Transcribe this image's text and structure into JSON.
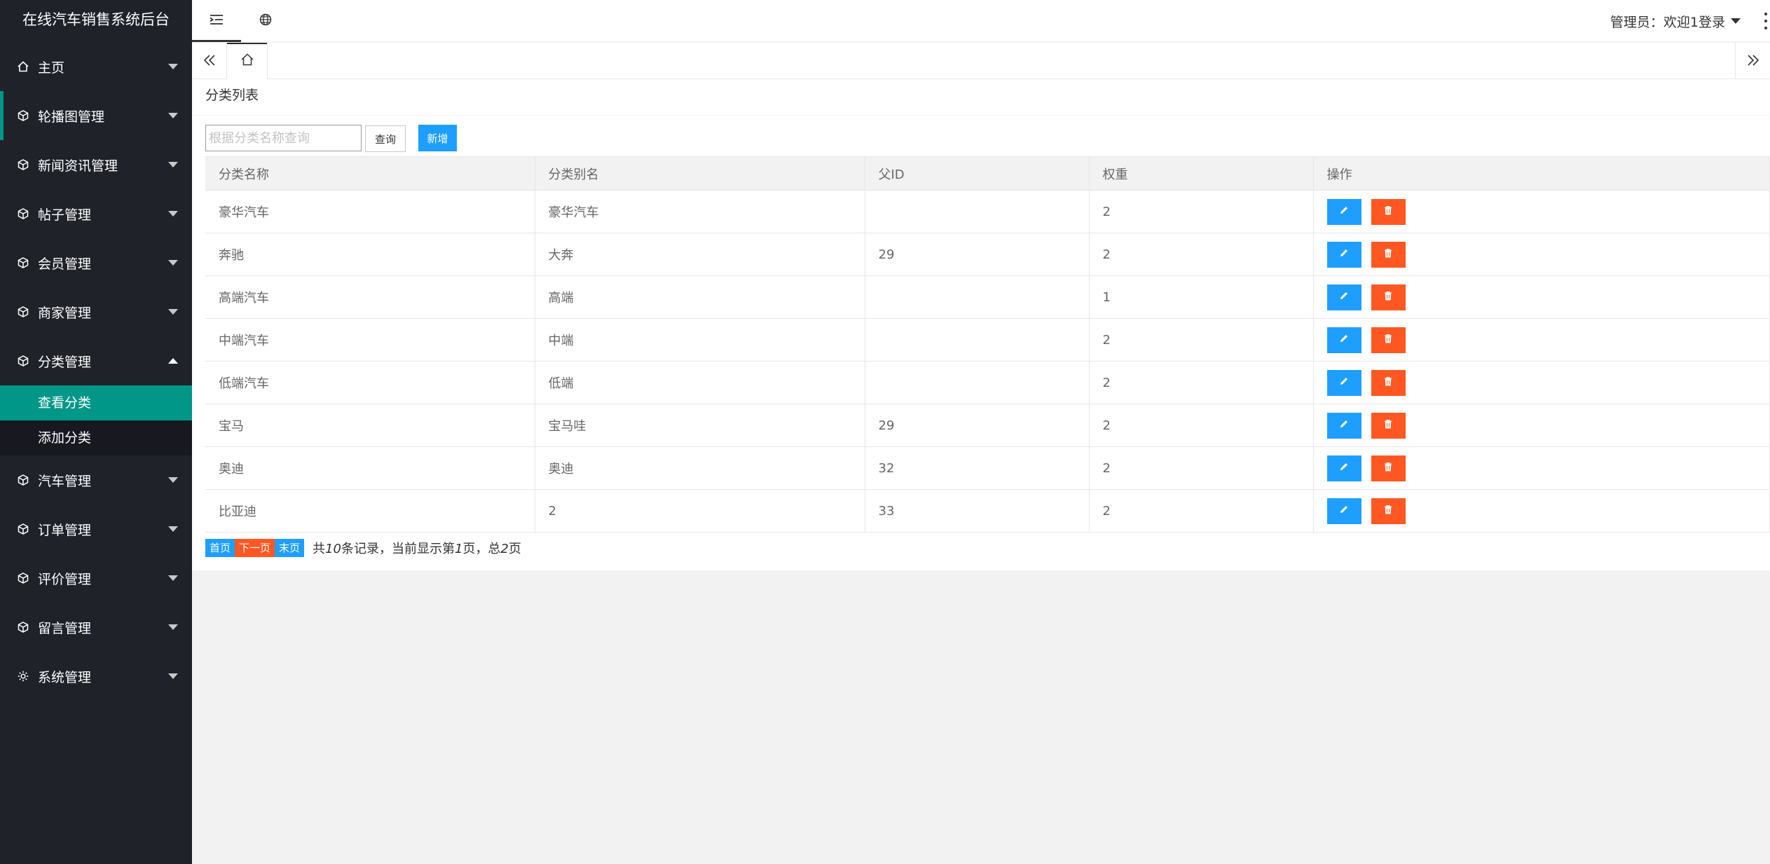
{
  "app": {
    "title": "在线汽车销售系统后台"
  },
  "header": {
    "admin_label": "管理员：欢迎1登录"
  },
  "sidebar": {
    "items": [
      {
        "label": "主页",
        "icon": "home-icon"
      },
      {
        "label": "轮播图管理",
        "icon": "cube-icon"
      },
      {
        "label": "新闻资讯管理",
        "icon": "cube-icon"
      },
      {
        "label": "帖子管理",
        "icon": "cube-icon"
      },
      {
        "label": "会员管理",
        "icon": "cube-icon"
      },
      {
        "label": "商家管理",
        "icon": "cube-icon"
      },
      {
        "label": "分类管理",
        "icon": "cube-icon",
        "expanded": true,
        "children": [
          {
            "label": "查看分类",
            "active": true
          },
          {
            "label": "添加分类"
          }
        ]
      },
      {
        "label": "汽车管理",
        "icon": "cube-icon"
      },
      {
        "label": "订单管理",
        "icon": "cube-icon"
      },
      {
        "label": "评价管理",
        "icon": "cube-icon"
      },
      {
        "label": "留言管理",
        "icon": "cube-icon"
      },
      {
        "label": "系统管理",
        "icon": "gear-icon"
      }
    ]
  },
  "main": {
    "card_title": "分类列表",
    "search": {
      "placeholder": "根据分类名称查询",
      "value": ""
    },
    "query_label": "查询",
    "add_label": "新增",
    "table": {
      "headers": [
        "分类名称",
        "分类别名",
        "父ID",
        "权重",
        "操作"
      ],
      "rows": [
        [
          "豪华汽车",
          "豪华汽车",
          "",
          "2"
        ],
        [
          "奔驰",
          "大奔",
          "29",
          "2"
        ],
        [
          "高端汽车",
          "高端",
          "",
          "1"
        ],
        [
          "中端汽车",
          "中端",
          "",
          "2"
        ],
        [
          "低端汽车",
          "低端",
          "",
          "2"
        ],
        [
          "宝马",
          "宝马哇",
          "29",
          "2"
        ],
        [
          "奥迪",
          "奥迪",
          "32",
          "2"
        ],
        [
          "比亚迪",
          "2",
          "33",
          "2"
        ]
      ]
    },
    "pager": {
      "first": "首页",
      "next": "下一页",
      "last": "末页",
      "info_prefix": "共",
      "total": "10",
      "info_mid": "条记录，当前显示第",
      "current": "1",
      "info_mid2": "页，总",
      "pages": "2",
      "info_suffix": "页"
    }
  },
  "colors": {
    "sidebar_bg": "#20222a",
    "accent": "#009688",
    "blue": "#1e9fff",
    "orange": "#ff5722"
  }
}
